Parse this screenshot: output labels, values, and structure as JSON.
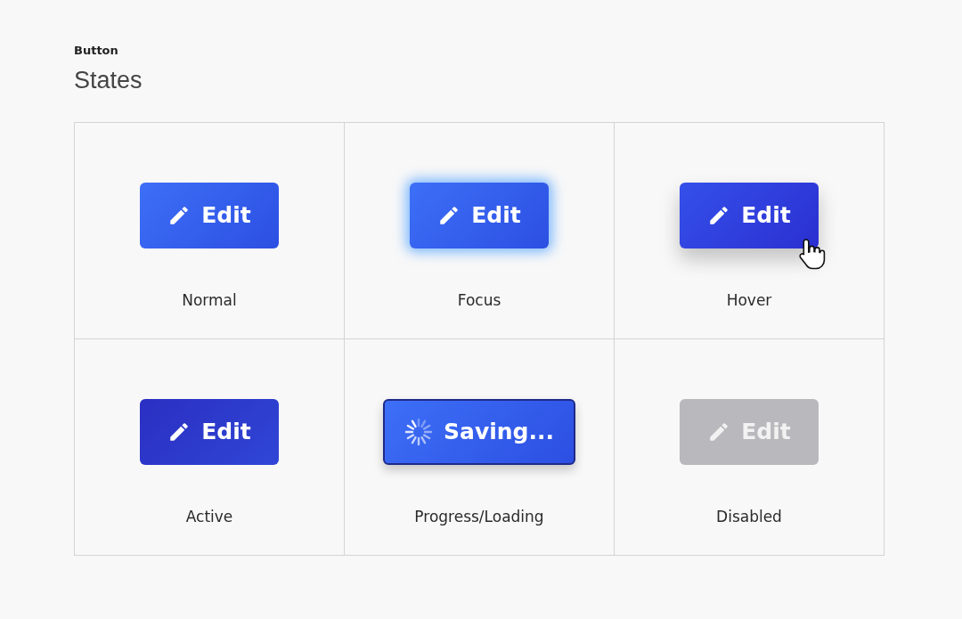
{
  "header": {
    "eyebrow": "Button",
    "title": "States"
  },
  "states": [
    {
      "kind": "normal",
      "button_text": "Edit",
      "label": "Normal"
    },
    {
      "kind": "focus",
      "button_text": "Edit",
      "label": "Focus"
    },
    {
      "kind": "hover",
      "button_text": "Edit",
      "label": "Hover"
    },
    {
      "kind": "active",
      "button_text": "Edit",
      "label": "Active"
    },
    {
      "kind": "loading",
      "button_text": "Saving...",
      "label": "Progress/Loading"
    },
    {
      "kind": "disabled",
      "button_text": "Edit",
      "label": "Disabled"
    }
  ]
}
